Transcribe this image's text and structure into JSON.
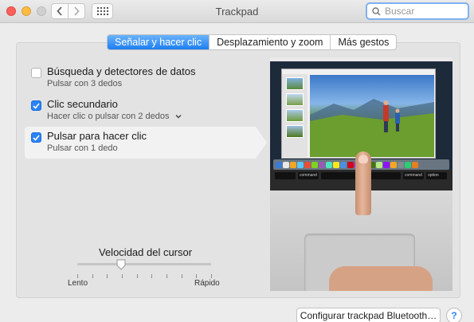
{
  "window": {
    "title": "Trackpad",
    "search_placeholder": "Buscar"
  },
  "tabs": [
    {
      "label": "Señalar y hacer clic",
      "active": true
    },
    {
      "label": "Desplazamiento y zoom",
      "active": false
    },
    {
      "label": "Más gestos",
      "active": false
    }
  ],
  "options": [
    {
      "title": "Búsqueda y detectores de datos",
      "subtitle": "Pulsar con 3 dedos",
      "checked": false
    },
    {
      "title": "Clic secundario",
      "subtitle": "Hacer clic o pulsar con 2 dedos",
      "checked": true,
      "has_dropdown": true
    },
    {
      "title": "Pulsar para hacer clic",
      "subtitle": "Pulsar con 1 dedo",
      "checked": true,
      "selected": true
    }
  ],
  "slider": {
    "label": "Velocidad del cursor",
    "min_label": "Lento",
    "max_label": "Rápido",
    "value_fraction": 0.33
  },
  "keyboard": {
    "left_key": "command",
    "right_key": "command",
    "option_key": "option"
  },
  "bottom": {
    "bluetooth_button": "Configurar trackpad Bluetooth…",
    "help_label": "?"
  },
  "colors": {
    "accent": "#2b83f6",
    "close": "#fc605b",
    "minimize": "#fdbc40"
  }
}
